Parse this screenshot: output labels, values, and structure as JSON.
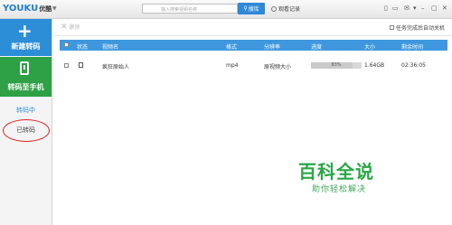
{
  "app": {
    "logo_main": "YOUKU",
    "logo_sub": "优酷"
  },
  "search": {
    "placeholder": "输入搜索视频名称",
    "button_label": "搜库",
    "history_label": "观看记录"
  },
  "window_controls": [
    "▯",
    "▭",
    "✉",
    "▾",
    "–",
    "▢",
    "✕"
  ],
  "sidebar": {
    "new_transcode": "新建转码",
    "to_phone": "转码至手机",
    "tab_transcoding": "转码中",
    "tab_transcoded": "已转码"
  },
  "toolbar": {
    "delete_label": "删除",
    "auto_shutdown_label": "任务完成后自动关机"
  },
  "table": {
    "columns": [
      "状态",
      "视频名",
      "格式",
      "分辨率",
      "进度",
      "大小",
      "剩余时间"
    ],
    "rows": [
      {
        "name": "疯狂原始人",
        "format": "mp4",
        "resolution": "原视频大小",
        "progress_text": "83%",
        "progress": 0.83,
        "size": "1.64GB",
        "remaining": "02:36:05"
      }
    ]
  },
  "watermark": {
    "title": "百科全说",
    "subtitle": "助你轻松解决"
  },
  "colors": {
    "primary_blue": "#2d8ed8",
    "green": "#2ea045",
    "header_blue": "#3f98dd",
    "circle_red": "#e02020"
  }
}
